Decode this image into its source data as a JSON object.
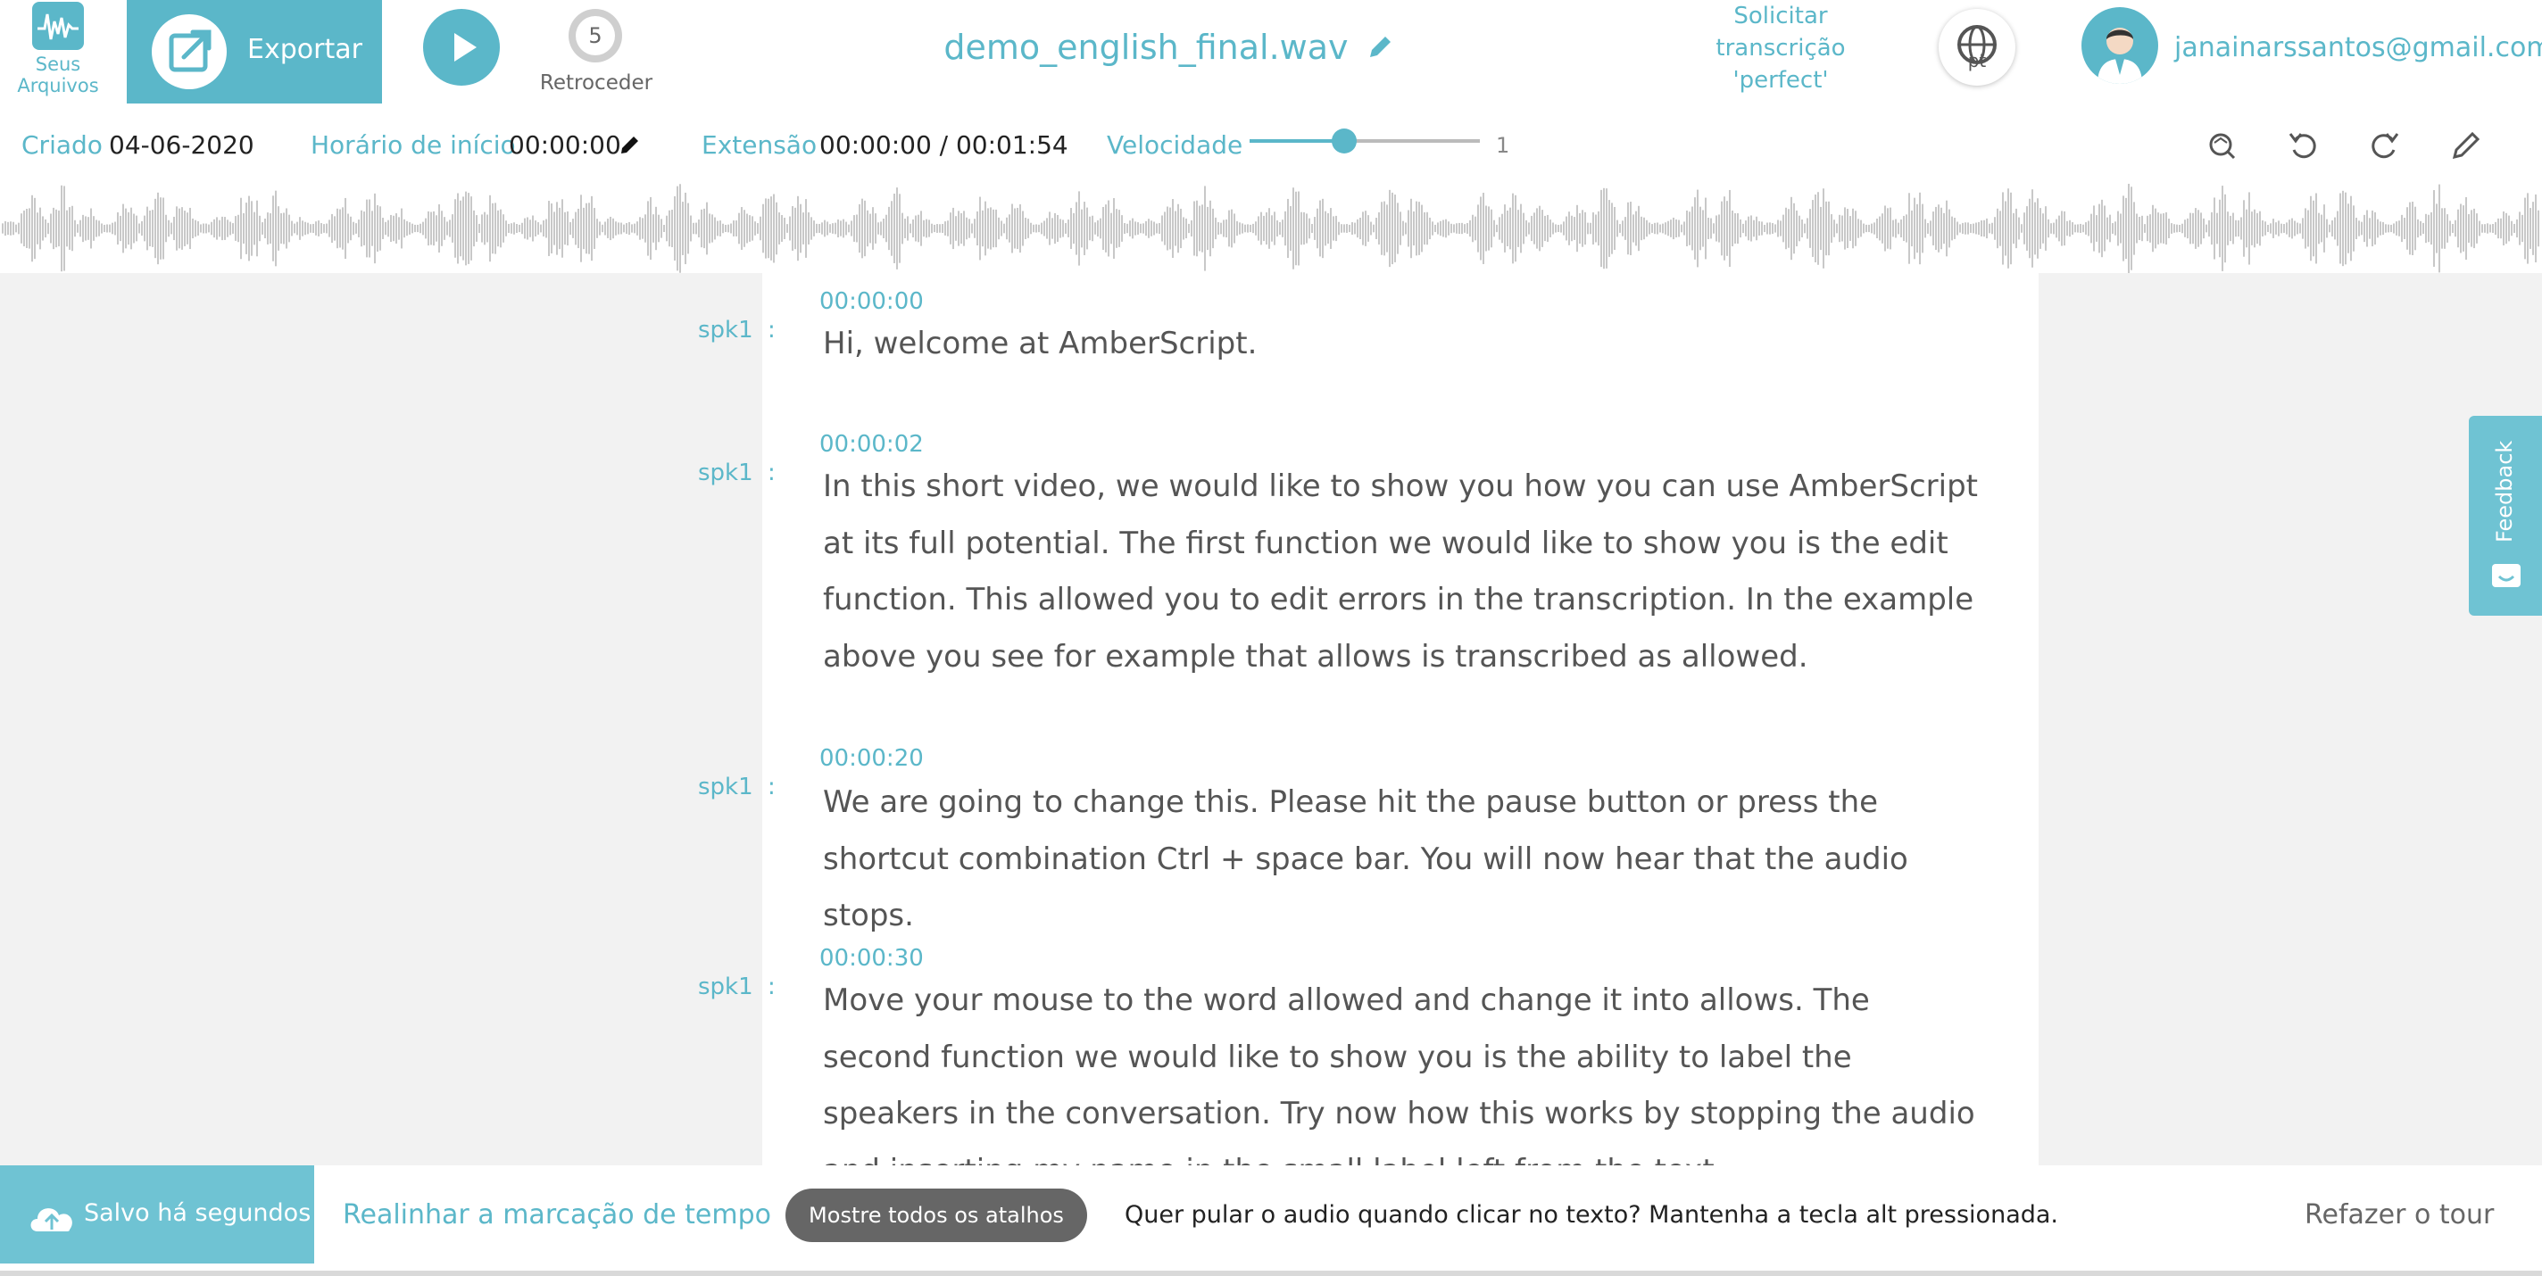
{
  "header": {
    "files_label_line1": "Seus",
    "files_label_line2": "Arquivos",
    "export_label": "Exportar",
    "rewind_seconds": "5",
    "rewind_label": "Retroceder",
    "filename": "demo_english_final.wav",
    "order_perfect_line1": "Solicitar",
    "order_perfect_line2": "transcrição",
    "order_perfect_line3": "'perfect'",
    "language_code": "pt",
    "user_email": "janainarssantos@gmail.com"
  },
  "info": {
    "created_label": "Criado",
    "created_value": "04-06-2020",
    "start_label": "Horário de início",
    "start_value": "00:00:00",
    "length_label": "Extensão",
    "length_value": "00:00:00 / 00:01:54",
    "speed_label": "Velocidade",
    "speed_value": "1"
  },
  "transcript": [
    {
      "speaker": "spk1",
      "time": "00:00:00",
      "text": "Hi, welcome at AmberScript."
    },
    {
      "speaker": "spk1",
      "time": "00:00:02",
      "text": "In this short video, we would like to show you how you can use AmberScript at its full potential. The first function we would like to show you is the edit function. This allowed you to edit errors in the transcription. In the example above you see for example that allows is transcribed as allowed."
    },
    {
      "speaker": "spk1",
      "time": "00:00:20",
      "text": "We are going to change this. Please hit the pause button or press the shortcut combination Ctrl + space bar. You will now hear that the audio stops."
    },
    {
      "speaker": "spk1",
      "time": "00:00:30",
      "text": "Move your mouse to the word allowed and change it into allows. The second function we would like to show you is the ability to label the speakers in the conversation. Try now how this works by stopping the audio and inserting my name in the small label left from the text."
    }
  ],
  "feedback_label": "Feedback",
  "footer": {
    "saved_label": "Salvo há segundos",
    "realign_label": "Realinhar a marcação de tempo",
    "shortcuts_label": "Mostre todos os atalhos",
    "hint_text": "Quer pular o audio quando clicar no texto? Mantenha a tecla alt pressionada.",
    "redo_tour_label": "Refazer o tour"
  },
  "colors": {
    "accent": "#5bb7c9",
    "accent_light": "#6fc3d3",
    "waveform": "#c8c8c8",
    "background": "#f2f2f2"
  },
  "icons": {
    "logo": "waveform-logo-icon",
    "export": "export-icon",
    "play": "play-icon",
    "rewind": "rewind-5-icon",
    "edit": "pencil-icon",
    "language": "globe-icon",
    "search_replace": "search-replace-icon",
    "undo": "undo-icon",
    "redo": "redo-icon",
    "cloud": "cloud-upload-icon",
    "feedback": "feedback-face-icon"
  }
}
